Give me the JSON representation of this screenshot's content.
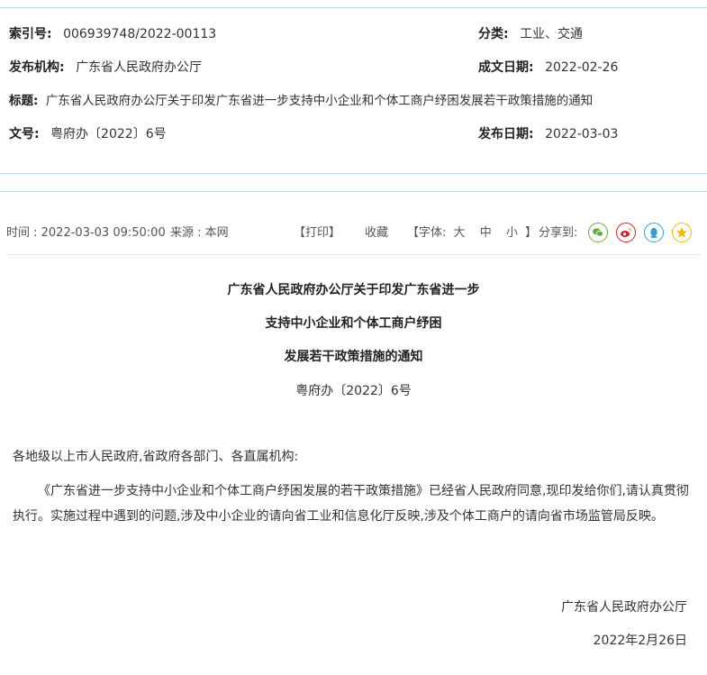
{
  "meta": {
    "index_label": "索引号:",
    "index_value": "006939748/2022-00113",
    "category_label": "分类:",
    "category_value": "工业、交通",
    "publisher_label": "发布机构:",
    "publisher_value": "广东省人民政府办公厅",
    "created_label": "成文日期:",
    "created_value": "2022-02-26",
    "title_label": "标题:",
    "title_value": "广东省人民政府办公厅关于印发广东省进一步支持中小企业和个体工商户纾困发展若干政策措施的通知",
    "docno_label": "文号:",
    "docno_value": "粤府办〔2022〕6号",
    "published_label": "发布日期:",
    "published_value": "2022-03-03"
  },
  "info": {
    "time": "时间 : 2022-03-03 09:50:00",
    "source": "来源 : 本网",
    "print": "【打印】",
    "favorite": "收藏",
    "font_prefix": "【字体:",
    "font_large": "大",
    "font_medium": "中",
    "font_small": "小",
    "font_suffix": "】",
    "share": "分享到:"
  },
  "share_icons": [
    {
      "name": "wechat-icon",
      "color": "#5cb531"
    },
    {
      "name": "weibo-icon",
      "color": "#e6162d"
    },
    {
      "name": "qq-icon",
      "color": "#2a9fd8"
    },
    {
      "name": "qzone-icon",
      "color": "#f5b800"
    }
  ],
  "article": {
    "title_1": "广东省人民政府办公厅关于印发广东省进一步",
    "title_2": "支持中小企业和个体工商户纾困",
    "title_3": "发展若干政策措施的通知",
    "doc_number": "粤府办〔2022〕6号",
    "salutation": "各地级以上市人民政府,省政府各部门、各直属机构:",
    "paragraph": "《广东省进一步支持中小企业和个体工商户纾困发展的若干政策措施》已经省人民政府同意,现印发给你们,请认真贯彻执行。实施过程中遇到的问题,涉及中小企业的请向省工业和信息化厅反映,涉及个体工商户的请向省市场监管局反映。",
    "signature": "广东省人民政府办公厅",
    "date": "2022年2月26日"
  }
}
